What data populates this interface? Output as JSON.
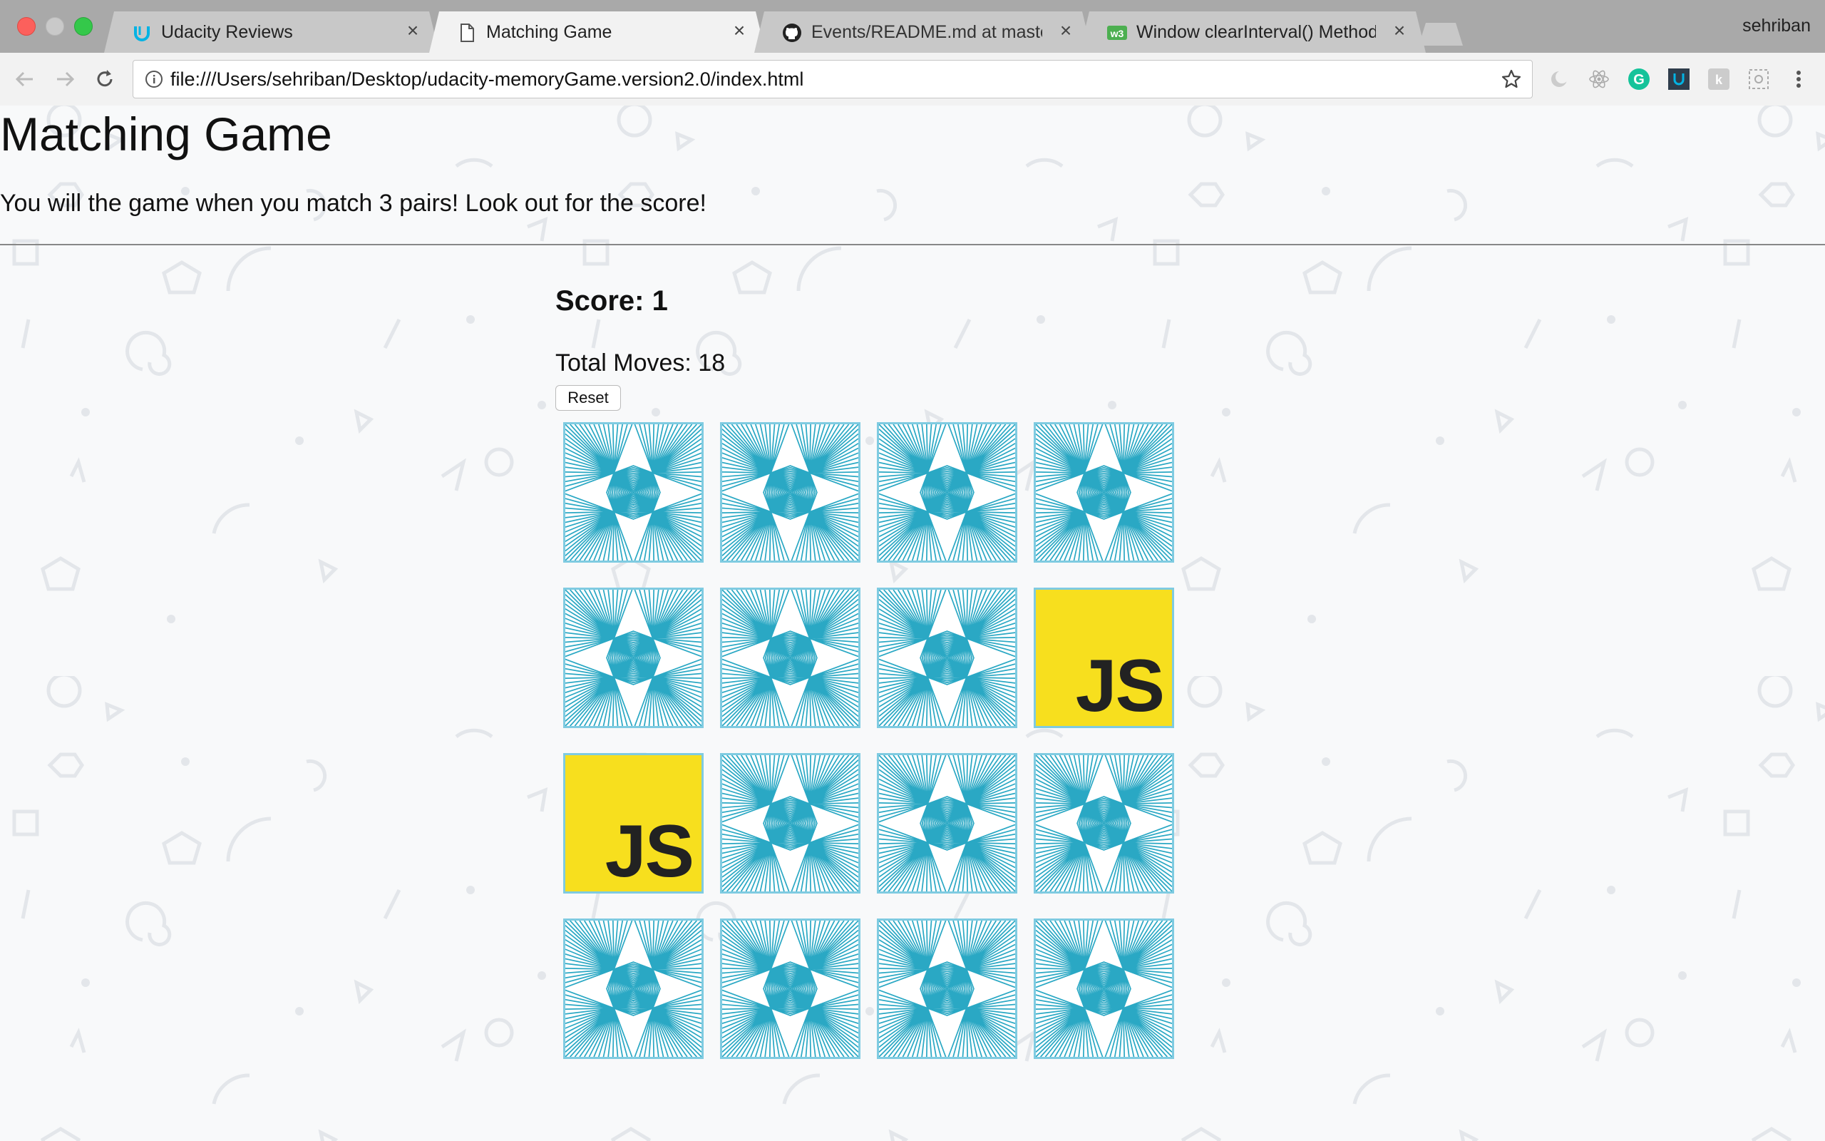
{
  "browser": {
    "tabs": [
      {
        "title": "Udacity Reviews",
        "icon": "udacity-icon",
        "active": false
      },
      {
        "title": "Matching Game",
        "icon": "document-icon",
        "active": true
      },
      {
        "title": "Events/README.md at master",
        "icon": "github-icon",
        "active": false
      },
      {
        "title": "Window clearInterval() Method",
        "icon": "w3schools-icon",
        "active": false
      }
    ],
    "close_glyph": "×",
    "profile_name": "sehriban",
    "url": "file:///Users/sehriban/Desktop/udacity-memoryGame.version2.0/index.html",
    "extensions": [
      "dark-reader-icon",
      "atom-icon",
      "grammarly-icon",
      "udacity-ext-icon",
      "k-ext-icon",
      "screenshot-ext-icon"
    ]
  },
  "page": {
    "title": "Matching Game",
    "intro": "You will the game when you match 3 pairs! Look out for the score!",
    "score": "Score: 1",
    "moves": "Total Moves: 18",
    "reset_label": "Reset"
  },
  "board": {
    "columns": 4,
    "rows": 4,
    "flipped_label": "JS",
    "flipped_indices": [
      7,
      8
    ],
    "colors": {
      "card_back": "#2aa8c4",
      "js_yellow": "#f7df1e",
      "card_border": "#7fcbe1"
    }
  }
}
